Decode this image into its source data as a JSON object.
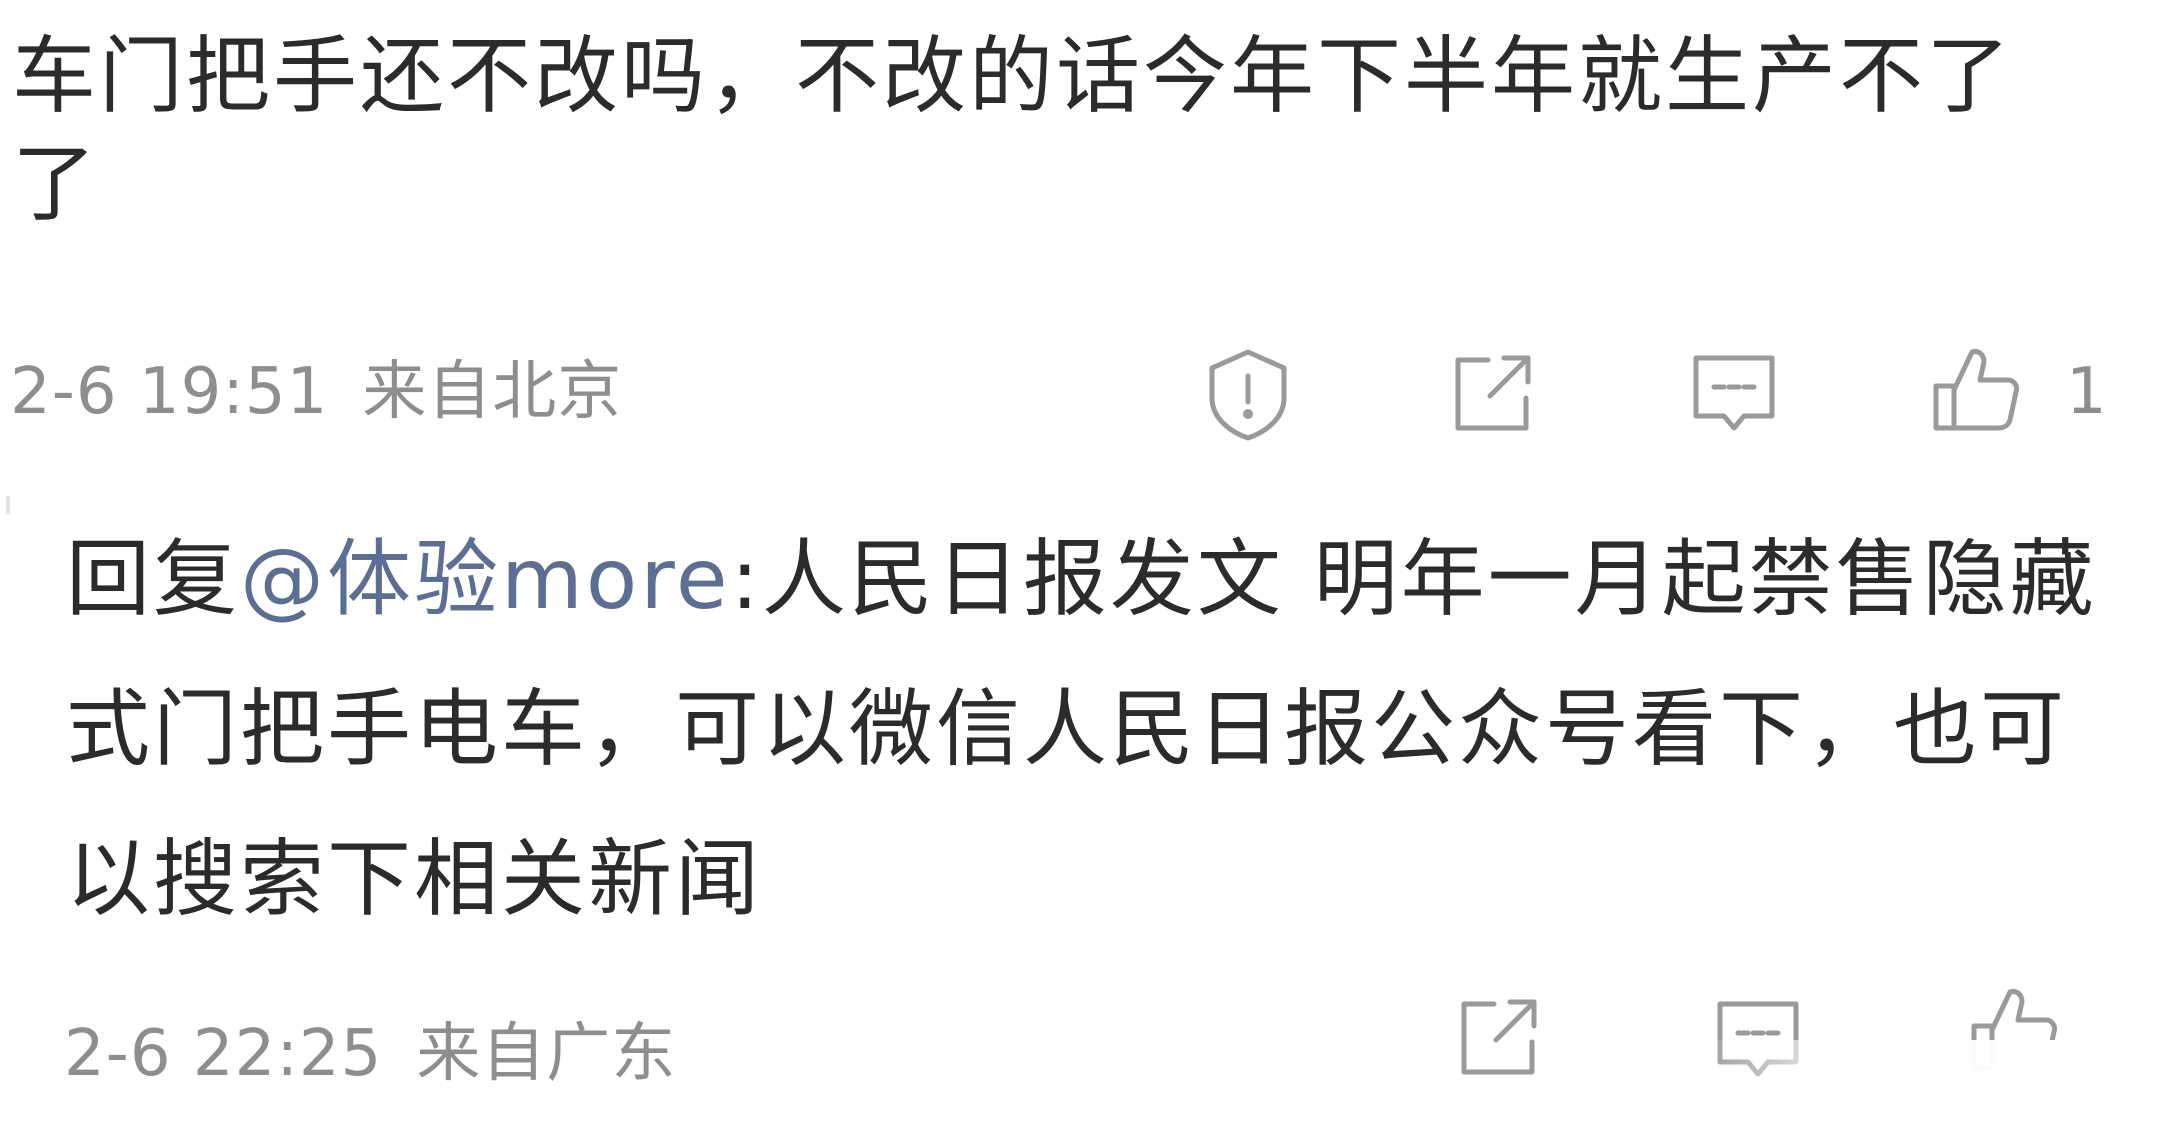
{
  "main_comment": {
    "text": "车门把手还不改吗，不改的话今年下半年就生产不了了",
    "timestamp": "2-6 19:51",
    "location": "来自北京",
    "like_count": "1",
    "icons": {
      "report": "shield-exclamation-icon",
      "share": "share-arrow-icon",
      "comment": "comment-bubble-icon",
      "like": "thumbs-up-icon"
    }
  },
  "reply": {
    "prefix": "回复",
    "mention": "@体验more",
    "text": ":人民日报发文 明年一月起禁售隐藏式门把手电车，可以微信人民日报公众号看下，也可以搜索下相关新闻",
    "timestamp": "2-6 22:25",
    "location": "来自广东",
    "icons": {
      "share": "share-arrow-icon",
      "comment": "comment-bubble-icon",
      "like": "thumbs-up-icon"
    }
  },
  "colors": {
    "text": "#2b2b2b",
    "meta": "#8e8e8e",
    "mention": "#5b6e94",
    "icon": "#9a9a9a"
  }
}
